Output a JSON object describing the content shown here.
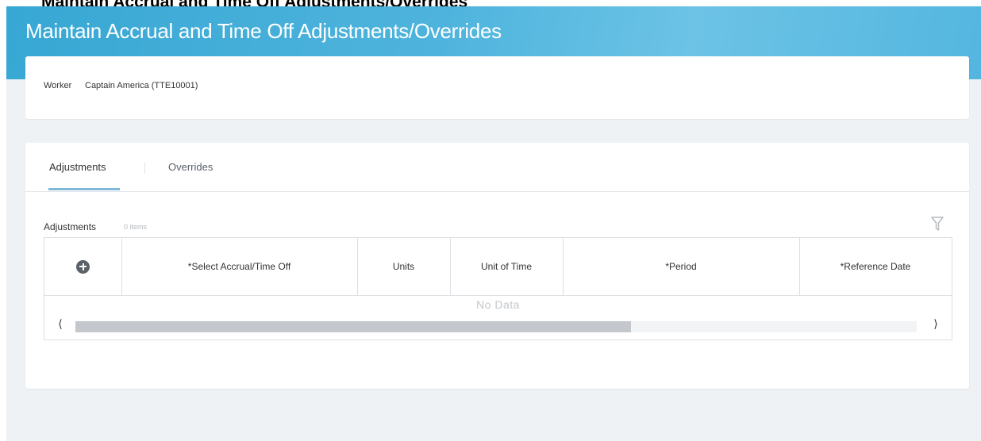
{
  "document_heading": "Maintain Accrual and Time Off Adjustments/Overrides",
  "page": {
    "title": "Maintain Accrual and Time Off Adjustments/Overrides"
  },
  "worker": {
    "label": "Worker",
    "value": "Captain America (TTE10001)"
  },
  "tabs": [
    {
      "label": "Adjustments",
      "active": true
    },
    {
      "label": "Overrides",
      "active": false
    }
  ],
  "grid": {
    "title": "Adjustments",
    "count": "0 items",
    "columns": [
      "*Select Accrual/Time Off",
      "Units",
      "Unit of Time",
      "*Period",
      "*Reference Date"
    ],
    "empty_text": "No Data",
    "scroll_position": 0.66
  },
  "icons": {
    "add": "add-circle-icon",
    "filter": "filter-icon",
    "scroll_left": "chevron-left-icon",
    "scroll_right": "chevron-right-icon"
  },
  "colors": {
    "banner": "#37a7d3",
    "tab_underline": "#7fb8d8",
    "background": "#eef2f5"
  }
}
